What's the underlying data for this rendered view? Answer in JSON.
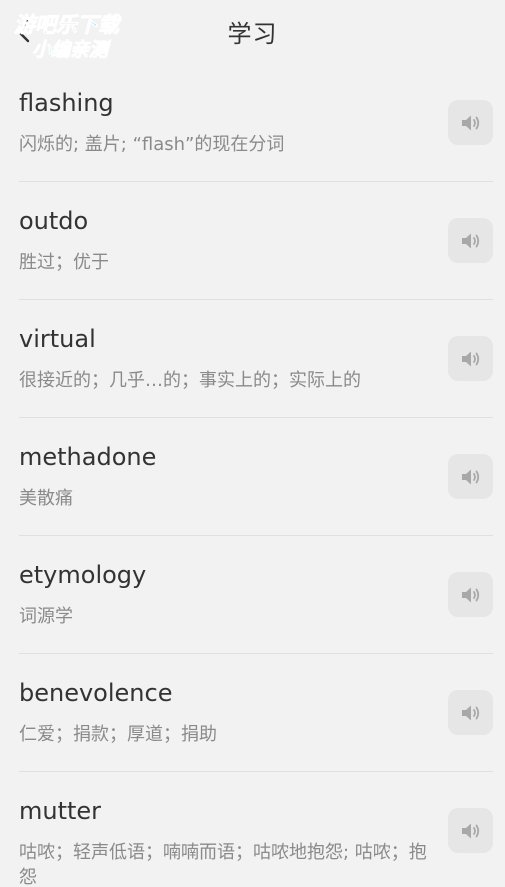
{
  "header": {
    "title": "学习",
    "back_icon": "chevron-left-icon"
  },
  "watermark": {
    "line1": "游吧乐下载",
    "line2": "小编亲测"
  },
  "colors": {
    "background": "#f2f2f2",
    "word": "#333333",
    "meaning": "#8a8a8a",
    "speaker_bg": "#e6e6e6",
    "speaker_icon": "#a8a8a8",
    "watermark_fill": "#29b8e0"
  },
  "words": [
    {
      "word": "flashing",
      "meaning": "闪烁的; 盖片; “flash”的现在分词",
      "icon": "speaker-icon"
    },
    {
      "word": "outdo",
      "meaning": "胜过；优于",
      "icon": "speaker-icon"
    },
    {
      "word": "virtual",
      "meaning": "很接近的；几乎…的；事实上的；实际上的",
      "icon": "speaker-icon"
    },
    {
      "word": "methadone",
      "meaning": "美散痛",
      "icon": "speaker-icon"
    },
    {
      "word": "etymology",
      "meaning": "词源学",
      "icon": "speaker-icon"
    },
    {
      "word": "benevolence",
      "meaning": "仁爱；捐款；厚道；捐助",
      "icon": "speaker-icon"
    },
    {
      "word": "mutter",
      "meaning": "咕哝；轻声低语；喃喃而语；咕哝地抱怨; 咕哝；抱怨",
      "icon": "speaker-icon"
    }
  ]
}
